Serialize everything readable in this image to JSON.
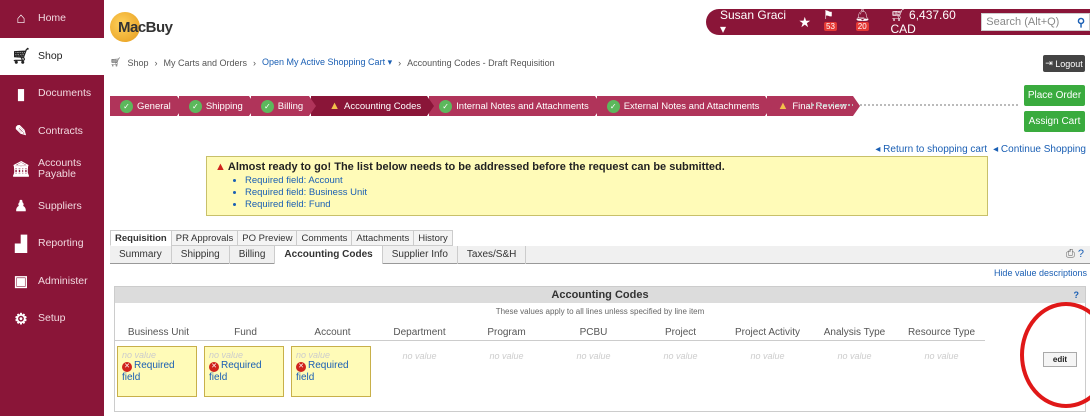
{
  "sidebar": {
    "items": [
      {
        "label": "Home",
        "icon": "home-icon"
      },
      {
        "label": "Shop",
        "icon": "cart-icon"
      },
      {
        "label": "Documents",
        "icon": "documents-icon"
      },
      {
        "label": "Contracts",
        "icon": "contracts-icon"
      },
      {
        "label": "Accounts Payable",
        "icon": "bank-icon"
      },
      {
        "label": "Suppliers",
        "icon": "suppliers-icon"
      },
      {
        "label": "Reporting",
        "icon": "chart-icon"
      },
      {
        "label": "Administer",
        "icon": "administer-icon"
      },
      {
        "label": "Setup",
        "icon": "gear-icon"
      }
    ]
  },
  "header": {
    "logo_text": "MacBuy",
    "user_name": "Susan Graci ▾",
    "flag_count": "53",
    "alert_count": "20",
    "cart_total": "6,437.60 CAD",
    "search_placeholder": "Search (Alt+Q)",
    "logout_label": "Logout"
  },
  "breadcrumb": {
    "shop": "Shop",
    "carts": "My Carts and Orders",
    "active_cart": "Open My Active Shopping Cart ▾",
    "current": "Accounting Codes - Draft Requisition"
  },
  "wizard": {
    "steps": [
      {
        "label": "General",
        "state": "complete"
      },
      {
        "label": "Shipping",
        "state": "complete"
      },
      {
        "label": "Billing",
        "state": "complete"
      },
      {
        "label": "Accounting Codes",
        "state": "warning"
      },
      {
        "label": "Internal Notes and Attachments",
        "state": "complete"
      },
      {
        "label": "External Notes and Attachments",
        "state": "complete"
      },
      {
        "label": "Final Review",
        "state": "warning"
      }
    ]
  },
  "actions": {
    "place_order": "Place Order",
    "assign_cart": "Assign Cart",
    "return_cart": "Return to shopping cart",
    "continue_shopping": "Continue Shopping"
  },
  "alert": {
    "title": "Almost ready to go! The list below needs to be addressed before the request can be submitted.",
    "items": [
      "Required field: Account",
      "Required field: Business Unit",
      "Required field: Fund"
    ]
  },
  "tabs_primary": [
    "Requisition",
    "PR Approvals",
    "PO Preview",
    "Comments",
    "Attachments",
    "History"
  ],
  "tabs_secondary": [
    "Summary",
    "Shipping",
    "Billing",
    "Accounting Codes",
    "Supplier Info",
    "Taxes/S&H"
  ],
  "hide_values": "Hide value descriptions",
  "panel": {
    "title": "Accounting Codes",
    "help": "?",
    "subtitle": "These values apply to all lines unless specified by line item",
    "columns": [
      "Business Unit",
      "Fund",
      "Account",
      "Department",
      "Program",
      "PCBU",
      "Project",
      "Project Activity",
      "Analysis Type",
      "Resource Type"
    ],
    "no_value": "no value",
    "required_label": "Required field",
    "edit_label": "edit"
  },
  "colors": {
    "brand": "#8a1538",
    "step": "#b0345a",
    "green": "#3aab3e",
    "link": "#1a5fb4",
    "highlight_circle": "#e01818"
  }
}
